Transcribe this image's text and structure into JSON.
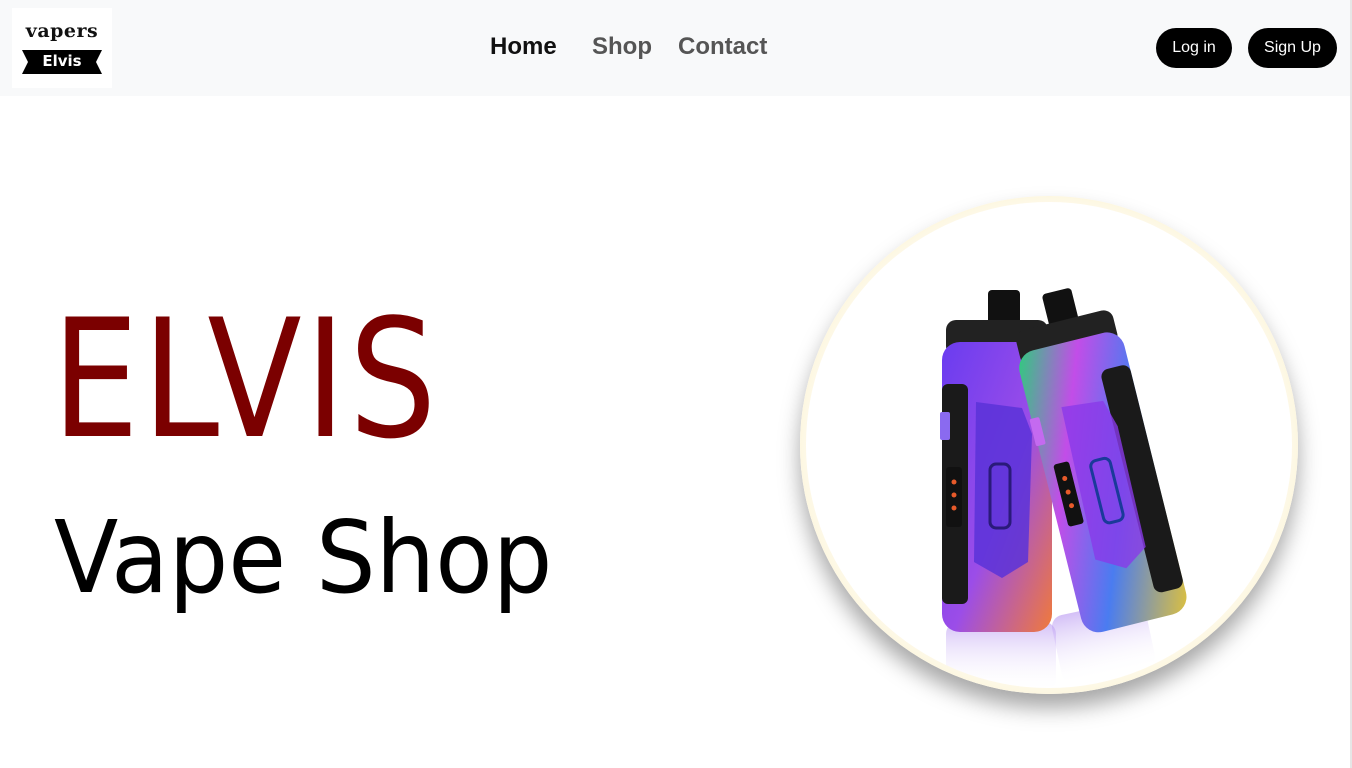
{
  "brand": {
    "logo_top": "vapers",
    "logo_bottom": "Elvis"
  },
  "nav": {
    "links": [
      {
        "label": "Home"
      },
      {
        "label": "Shop"
      },
      {
        "label": "Contact"
      }
    ]
  },
  "auth": {
    "login_label": "Log in",
    "signup_label": "Sign Up"
  },
  "hero": {
    "title": "ELVIS",
    "subtitle": "Vape Shop",
    "image_icon": "vape-device-product-image"
  },
  "colors": {
    "nav_bg": "#f8f9fa",
    "title": "#7b0000",
    "button_bg": "#000000",
    "button_text": "#ffffff",
    "ring_gold": "#a07a22"
  }
}
